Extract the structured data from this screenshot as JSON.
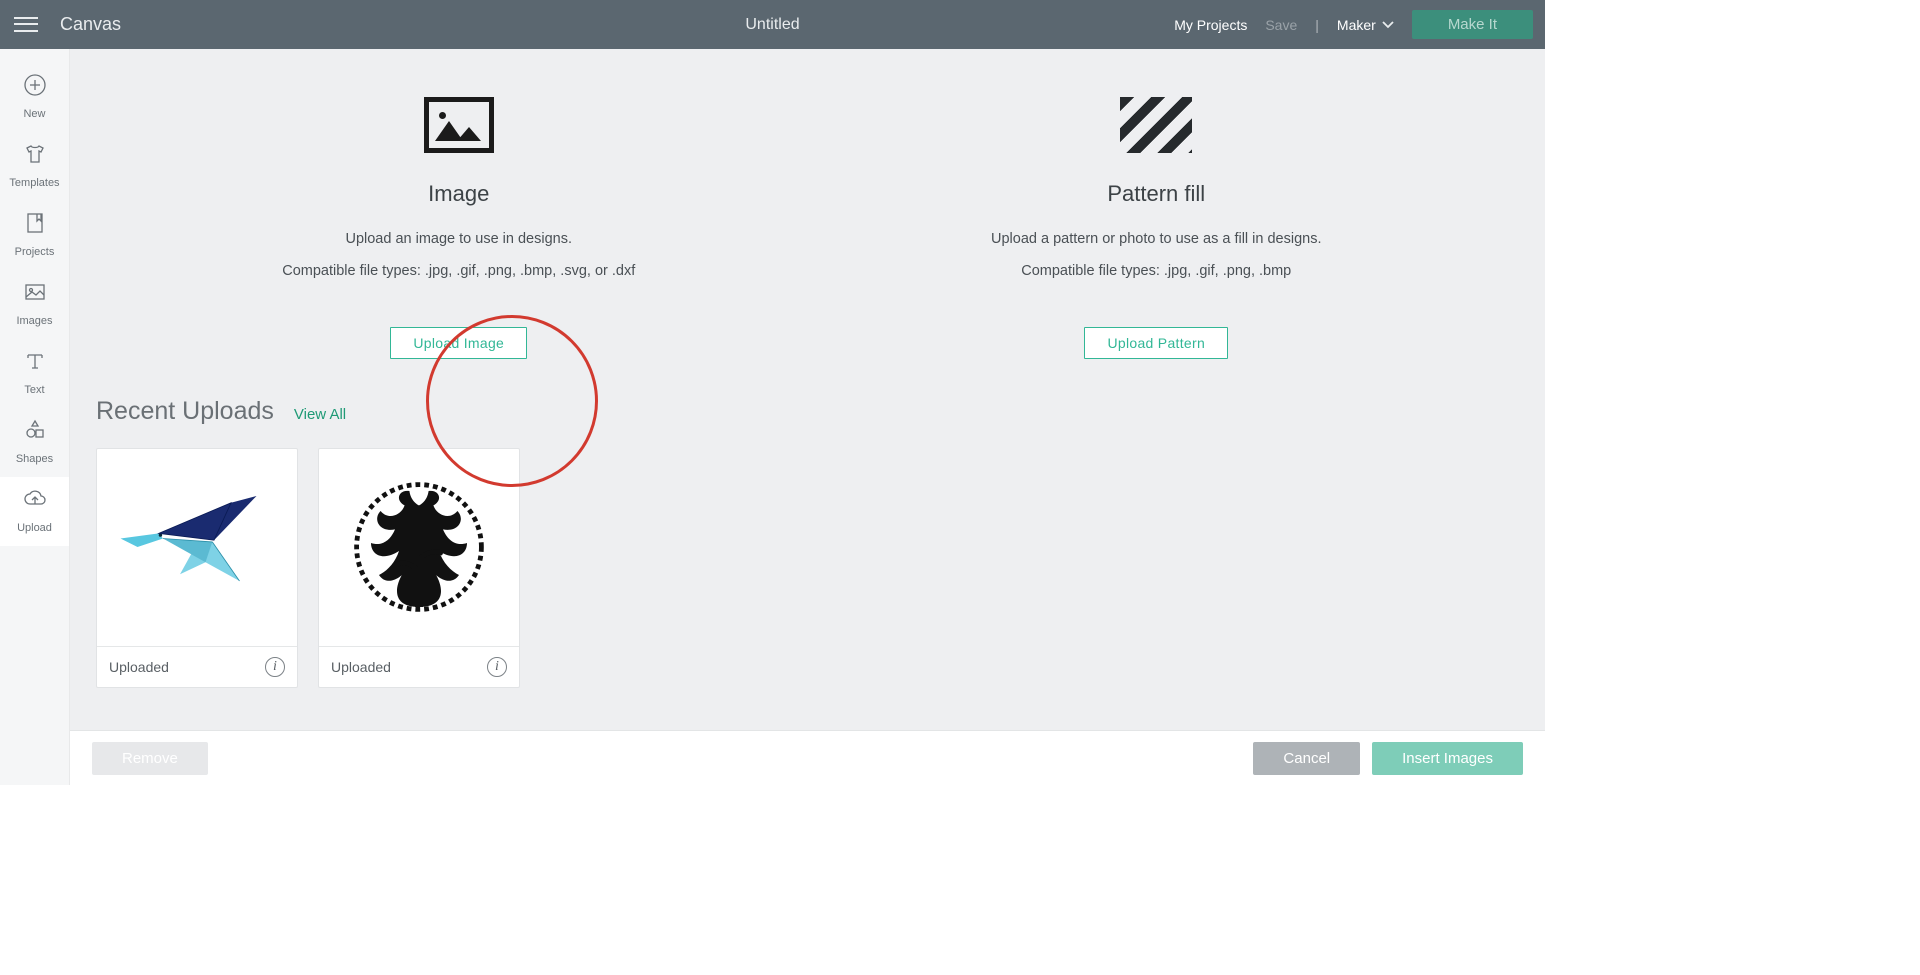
{
  "topbar": {
    "canvas": "Canvas",
    "title": "Untitled",
    "myProjects": "My Projects",
    "save": "Save",
    "separator": "|",
    "machine": "Maker",
    "makeIt": "Make It"
  },
  "sidebar": {
    "items": [
      {
        "id": "new",
        "label": "New"
      },
      {
        "id": "templates",
        "label": "Templates"
      },
      {
        "id": "projects",
        "label": "Projects"
      },
      {
        "id": "images",
        "label": "Images"
      },
      {
        "id": "text",
        "label": "Text"
      },
      {
        "id": "shapes",
        "label": "Shapes"
      },
      {
        "id": "upload",
        "label": "Upload"
      }
    ]
  },
  "upload": {
    "image": {
      "title": "Image",
      "line1": "Upload an image to use in designs.",
      "line2": "Compatible file types: .jpg, .gif, .png, .bmp, .svg, or .dxf",
      "button": "Upload Image"
    },
    "pattern": {
      "title": "Pattern fill",
      "line1": "Upload a pattern or photo to use as a fill in designs.",
      "line2": "Compatible file types: .jpg, .gif, .png, .bmp",
      "button": "Upload Pattern"
    }
  },
  "recent": {
    "heading": "Recent Uploads",
    "viewAll": "View All",
    "items": [
      {
        "label": "Uploaded",
        "kind": "hummingbird"
      },
      {
        "label": "Uploaded",
        "kind": "tree"
      }
    ]
  },
  "bottom": {
    "remove": "Remove",
    "cancel": "Cancel",
    "insert": "Insert Images"
  },
  "annotation": {
    "highlight": "upload-image-button"
  }
}
